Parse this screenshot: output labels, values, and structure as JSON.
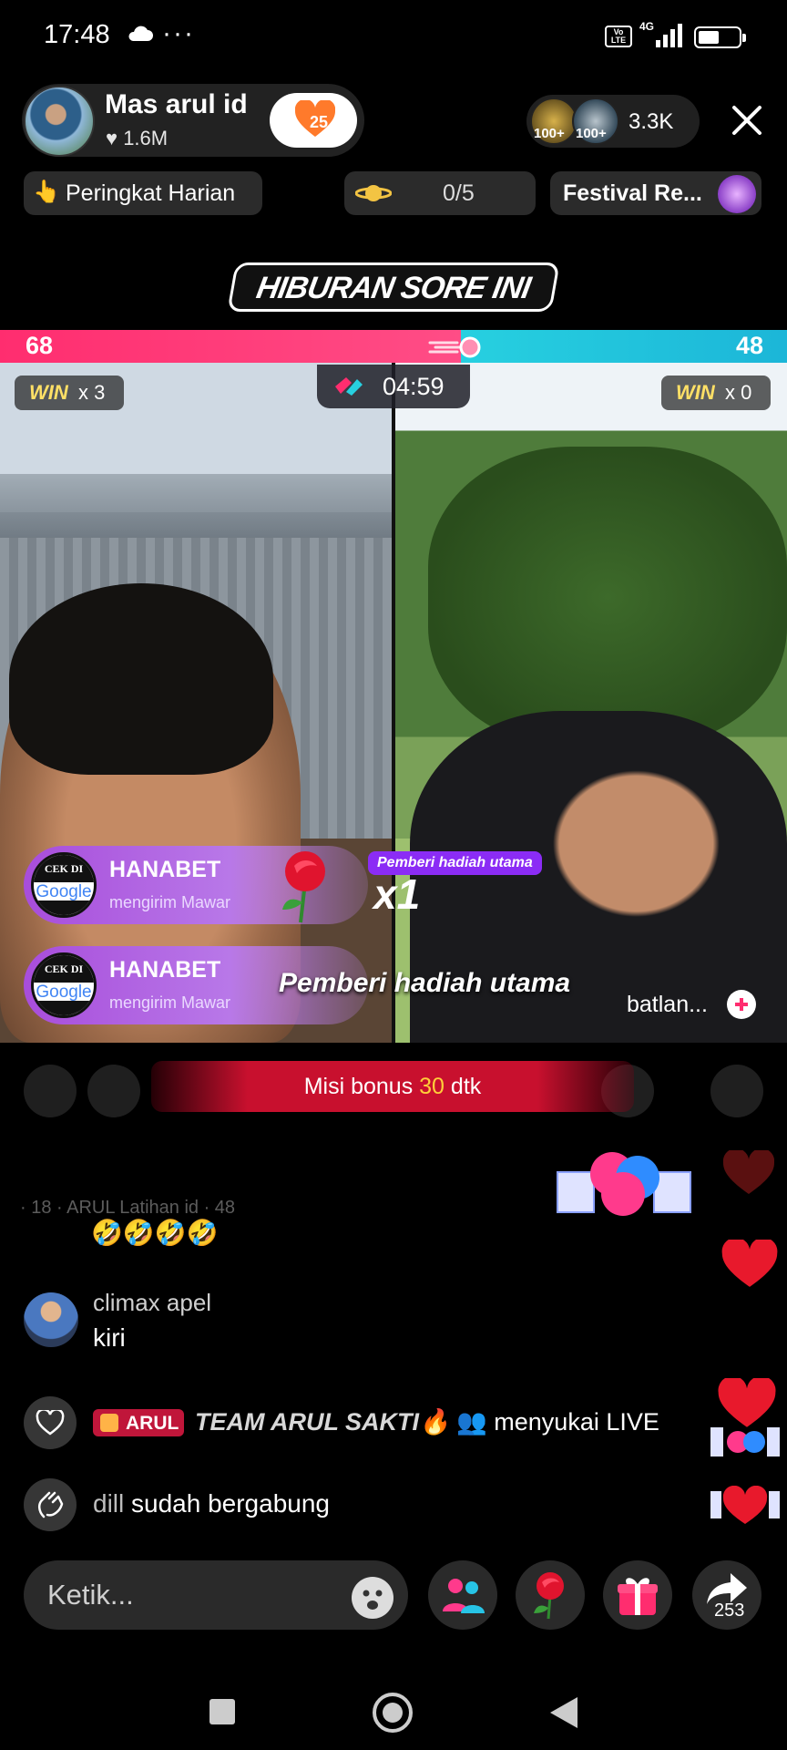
{
  "status_bar": {
    "time": "17:48",
    "more": "···",
    "network": "4G",
    "volte": "Vo LTE"
  },
  "host": {
    "name": "Mas arul id",
    "likes": "1.6M",
    "follow_badge": "25"
  },
  "viewers": {
    "top_badges": [
      "100+",
      "100+"
    ],
    "count": "3.3K"
  },
  "chips": {
    "ranking": "Peringkat Harian",
    "mission": "0/5",
    "festival": "Festival Re..."
  },
  "banner": "HIBURAN SORE INI",
  "battle": {
    "left_score": "68",
    "right_score": "48",
    "left_share": 0.586,
    "timer": "04:59",
    "left_win_label": "WIN",
    "left_win_count": "x 3",
    "right_win_label": "WIN",
    "right_win_count": "x 0"
  },
  "gifts": [
    {
      "avatar_top": "CEK DI",
      "avatar_brand": "Google",
      "name": "HANABET",
      "action": "mengirim Mawar"
    },
    {
      "avatar_top": "CEK DI",
      "avatar_brand": "Google",
      "name": "HANABET",
      "action": "mengirim Mawar"
    }
  ],
  "gift_overlay": {
    "tag": "Pemberi hadiah utama",
    "multiplier": "x1",
    "big_text": "Pemberi hadiah utama",
    "opponent_name": "batlan..."
  },
  "bonus": {
    "prefix": "Misi bonus",
    "seconds": "30",
    "suffix": "dtk"
  },
  "chat": {
    "faded_line": "· 18 · ARUL Latihan id · 48",
    "emojis": "🤣🤣🤣🤣",
    "comment_user": "climax apel",
    "comment_text": "kiri",
    "like_badge": "ARUL",
    "like_team": "TEAM ARUL SAKTI🔥",
    "like_action": "menyukai LIVE",
    "join_user": "dill",
    "join_action": "sudah bergabung"
  },
  "input": {
    "placeholder": "Ketik..."
  },
  "share_count": "253",
  "colors": {
    "left_team": "#ff2d6f",
    "right_team": "#27d0e0",
    "gift_purple": "#a84ddb",
    "bonus_red": "#c8102e",
    "heart_red": "#e8192c"
  }
}
